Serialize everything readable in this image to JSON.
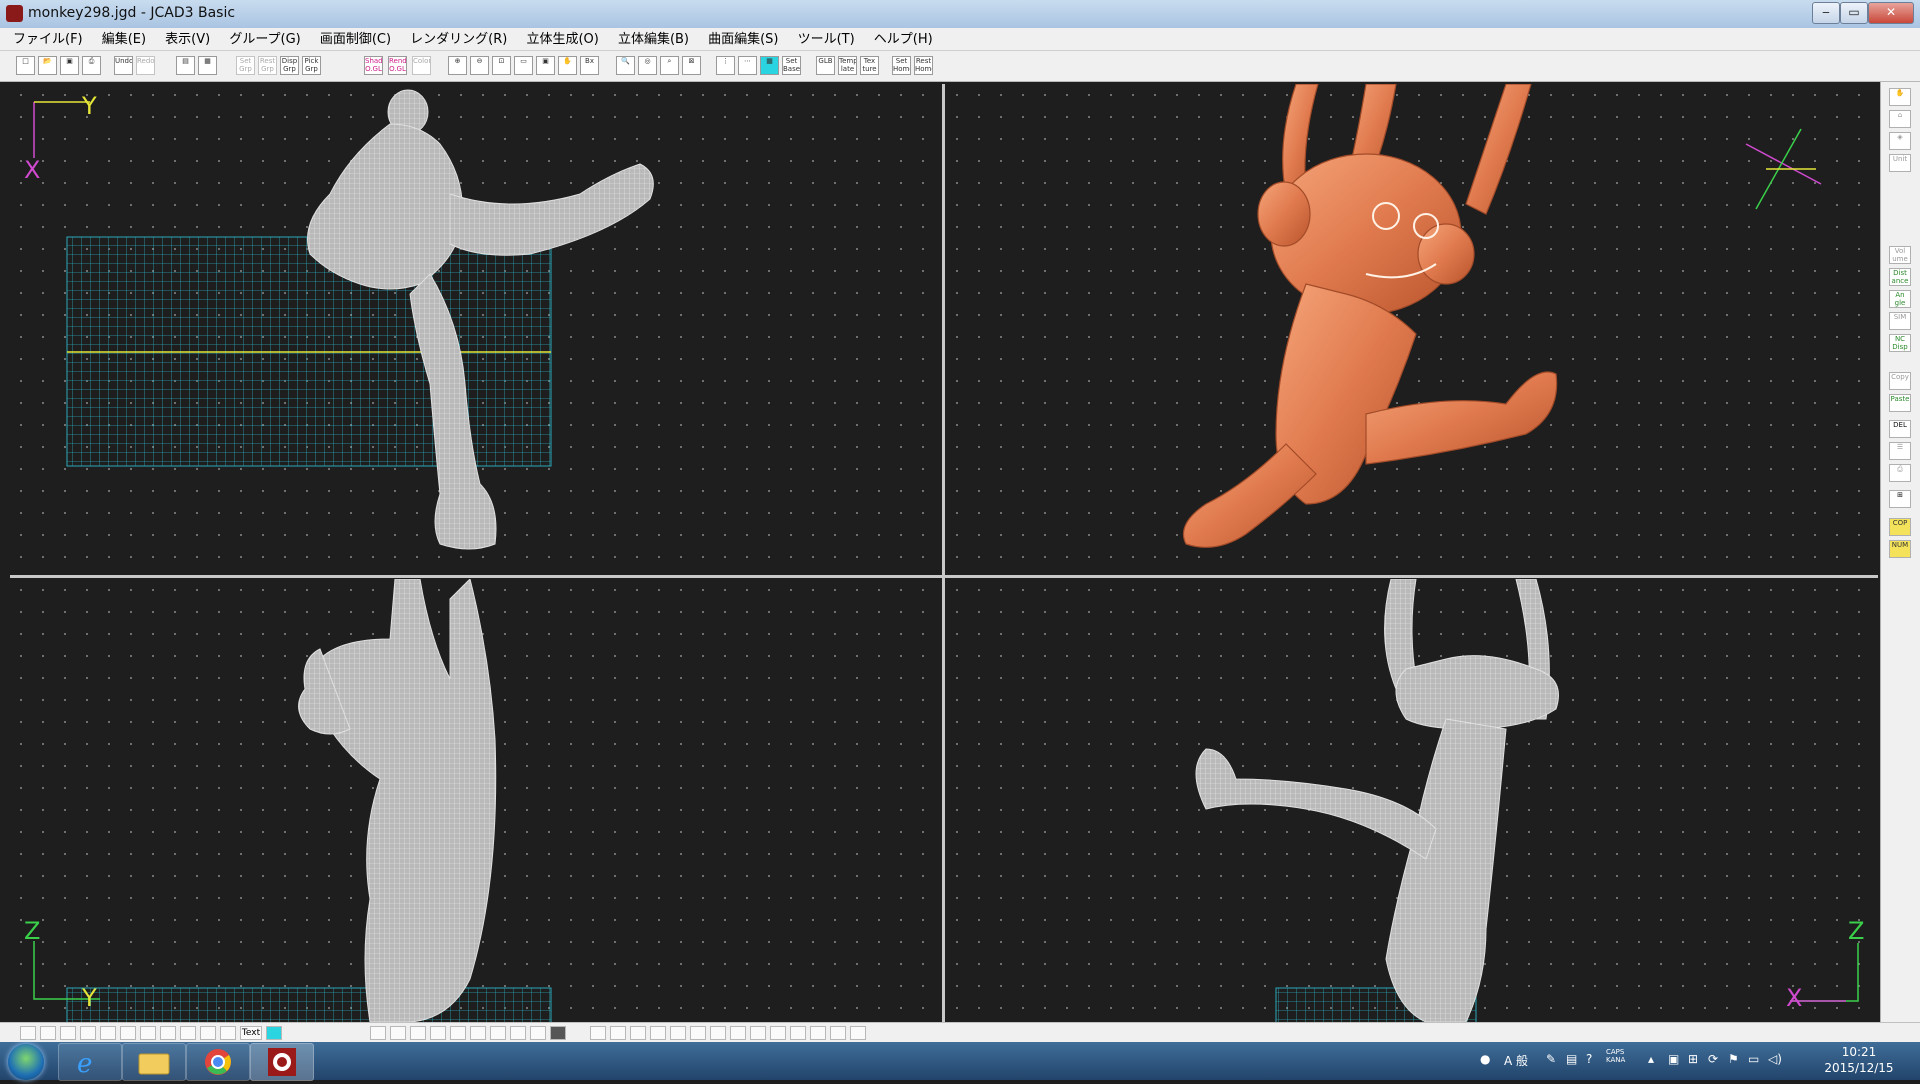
{
  "window": {
    "title": "monkey298.jgd - JCAD3 Basic",
    "minimize": "‒",
    "maximize": "▭",
    "close": "✕"
  },
  "menu": [
    "ファイル(F)",
    "編集(E)",
    "表示(V)",
    "グループ(G)",
    "画面制御(C)",
    "レンダリング(R)",
    "立体生成(O)",
    "立体編集(B)",
    "曲面編集(S)",
    "ツール(T)",
    "ヘルプ(H)"
  ],
  "toolbar": {
    "undo": "Undo",
    "redo": "Redo",
    "set_grp": "Set Grp",
    "reset_grp": "Rest Grp",
    "disp_grp": "Disp Grp",
    "pick_grp": "Pick Grp",
    "shad": "Shad O.GL",
    "rend": "Rend O.GL",
    "color": "Color",
    "set_base": "Set Base",
    "glb": "GLB",
    "template": "Temp late",
    "texture": "Tex ture",
    "set_home": "Set Home",
    "rest_home": "Rest Home",
    "bx": "Bx"
  },
  "viewports": {
    "top_left": {
      "h_axis": "Y",
      "v_axis": "X"
    },
    "bottom_left": {
      "h_axis": "Y",
      "v_axis": "Z"
    },
    "bottom_right": {
      "h_axis": "X",
      "v_axis": "Z"
    }
  },
  "sidebar": {
    "volume": "Vol ume",
    "distance": "Dist ance",
    "angle": "An gle",
    "sim": "SIM",
    "nc_disp": "NC Disp",
    "copy": "Copy",
    "paste": "Paste",
    "del": "DEL",
    "cop": "COP",
    "num": "NUM",
    "unit": "Unit"
  },
  "bottom": {
    "text_btn": "Text"
  },
  "taskbar": {
    "ime_mode": "A 般",
    "caps": "CAPS",
    "kana": "KANA",
    "time": "10:21",
    "date": "2015/12/15"
  },
  "colors": {
    "grid": "#2aa8b8",
    "model_wire": "#d4d4d4",
    "model_solid": "#e8845a",
    "axis_yellow": "#e6e63a",
    "axis_magenta": "#d04ad0",
    "axis_green": "#3ad04a"
  }
}
